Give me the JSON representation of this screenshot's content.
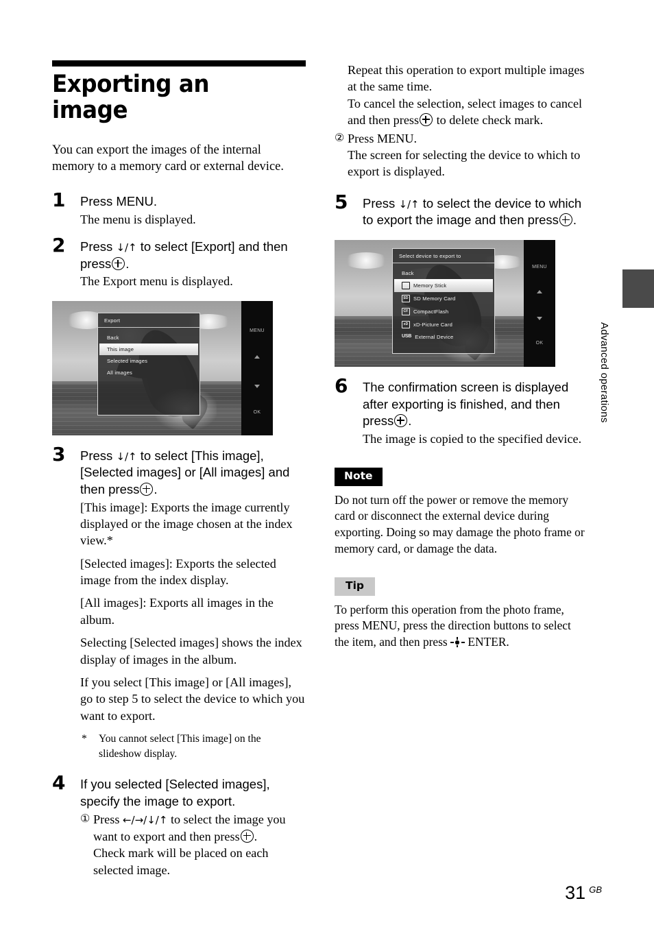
{
  "document": {
    "title": "Exporting an image",
    "intro": "You can export the images of the internal memory to a memory card or external device.",
    "side_tab_label": "Advanced operations",
    "page_number": "31",
    "page_region": "GB"
  },
  "steps": {
    "s1": {
      "number": "1",
      "head": "Press MENU.",
      "body": "The menu is displayed."
    },
    "s2": {
      "number": "2",
      "head_a": "Press",
      "head_arrows": "↓/↑",
      "head_b": "to select [Export] and then press",
      "head_end": ".",
      "body": "The Export menu is displayed."
    },
    "s3": {
      "number": "3",
      "head_a": "Press",
      "head_arrows": "↓/↑",
      "head_b": "to select [This image], [Selected images] or [All images] and then press",
      "head_end": ".",
      "body_1": "[This image]: Exports the image currently displayed or the image chosen at the index view.*",
      "body_2": "[Selected images]: Exports the selected image from the index display.",
      "body_3": "[All images]: Exports all images in the album.",
      "body_4": "Selecting [Selected images] shows the index display of images in the album.",
      "body_5": "If you select [This image] or [All images], go to step 5 to select the device to which you want to export.",
      "footnote_marker": "*",
      "footnote": "You cannot select [This image] on the slideshow display."
    },
    "s4": {
      "number": "4",
      "head": "If you selected [Selected images], specify the image to export.",
      "sub1_marker": "①",
      "sub1_a": "Press",
      "sub1_arrows": "←/→/↓/↑",
      "sub1_b": "to select the image you want to export and then press",
      "sub1_end": ".",
      "sub1_extra": "Check mark will be placed on each selected image.",
      "sub1_more_1": "Repeat this operation to export multiple images at the same time.",
      "sub2_cancel_a": "To cancel the selection, select images to cancel and then press",
      "sub2_cancel_b": "to delete check mark.",
      "sub2_marker": "②",
      "sub2_head": "Press MENU.",
      "sub2_body": "The screen for selecting the device to which to export is displayed."
    },
    "s5": {
      "number": "5",
      "head_a": "Press",
      "head_arrows": "↓/↑",
      "head_b": "to select the device to which to export the image and then press",
      "head_end": "."
    },
    "s6": {
      "number": "6",
      "head_a": "The confirmation screen is displayed after exporting is finished, and then press",
      "head_end": ".",
      "body": "The image is copied to the specified device."
    }
  },
  "screenshot_export_menu": {
    "osd_title": "Export",
    "items": [
      {
        "label": "Back",
        "selected": false,
        "icon": ""
      },
      {
        "label": "This image",
        "selected": true,
        "icon": ""
      },
      {
        "label": "Selected images",
        "selected": false,
        "icon": ""
      },
      {
        "label": "All images",
        "selected": false,
        "icon": ""
      }
    ],
    "bezel": {
      "menu": "MENU",
      "up": "up-triangle",
      "down": "down-triangle",
      "ok": "OK"
    }
  },
  "screenshot_device_select": {
    "osd_title": "Select device to export to",
    "items": [
      {
        "label": "Back",
        "selected": false,
        "icon": ""
      },
      {
        "label": "Memory Stick",
        "selected": true,
        "icon": "MS"
      },
      {
        "label": "SD Memory Card",
        "selected": false,
        "icon": "SD"
      },
      {
        "label": "CompactFlash",
        "selected": false,
        "icon": "CF"
      },
      {
        "label": "xD-Picture Card",
        "selected": false,
        "icon": "xD"
      },
      {
        "label": "External Device",
        "selected": false,
        "icon": "USB"
      }
    ],
    "bezel": {
      "menu": "MENU",
      "up": "up-triangle",
      "down": "down-triangle",
      "ok": "OK"
    }
  },
  "note": {
    "badge": "Note",
    "text": "Do not turn off the power or remove the memory card or disconnect the external device during exporting. Doing so may damage the photo frame or memory card, or damage the data."
  },
  "tip": {
    "badge": "Tip",
    "text_a": "To perform this operation from the photo frame, press MENU, press the direction buttons to select the item, and then press",
    "text_b": "ENTER."
  }
}
